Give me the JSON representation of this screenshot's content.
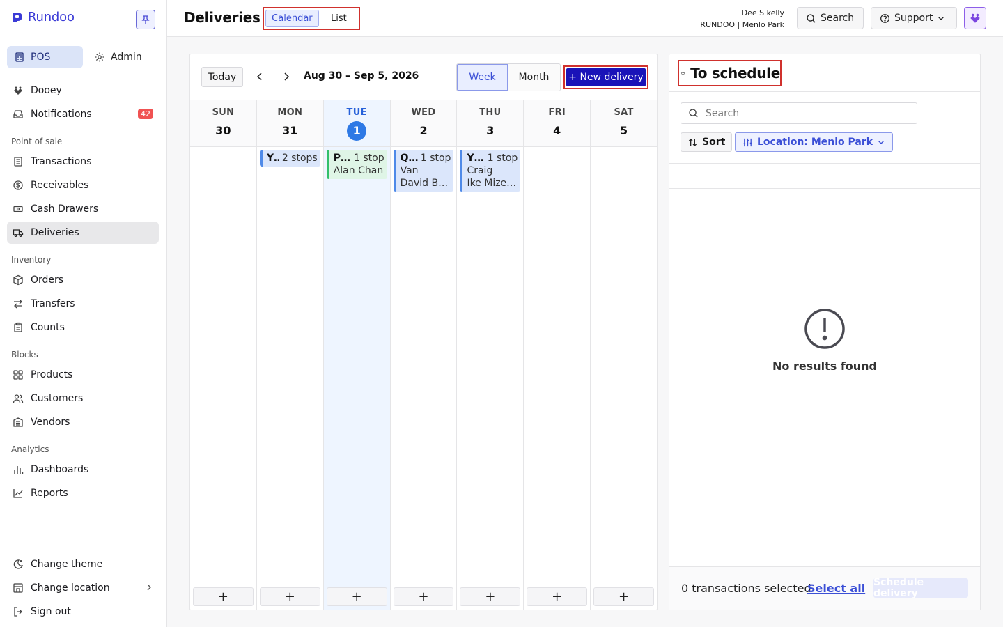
{
  "app": {
    "name": "Rundoo",
    "brand_color": "#3b3bd6"
  },
  "sidebar": {
    "mode_tabs": [
      {
        "label": "POS",
        "icon": "register-icon"
      },
      {
        "label": "Admin",
        "icon": "gear-icon"
      }
    ],
    "top_items": [
      {
        "label": "Dooey",
        "icon": "dooey-icon"
      },
      {
        "label": "Notifications",
        "icon": "inbox-icon",
        "badge": "42"
      }
    ],
    "sections": [
      {
        "title": "Point of sale",
        "items": [
          {
            "label": "Transactions",
            "icon": "receipt-icon"
          },
          {
            "label": "Receivables",
            "icon": "dollar-circle-icon"
          },
          {
            "label": "Cash Drawers",
            "icon": "cash-icon"
          },
          {
            "label": "Deliveries",
            "icon": "truck-icon",
            "active": true
          }
        ]
      },
      {
        "title": "Inventory",
        "items": [
          {
            "label": "Orders",
            "icon": "box-icon"
          },
          {
            "label": "Transfers",
            "icon": "arrows-icon"
          },
          {
            "label": "Counts",
            "icon": "clipboard-icon"
          }
        ]
      },
      {
        "title": "Blocks",
        "items": [
          {
            "label": "Products",
            "icon": "grid-icon"
          },
          {
            "label": "Customers",
            "icon": "users-icon"
          },
          {
            "label": "Vendors",
            "icon": "building-icon"
          }
        ]
      },
      {
        "title": "Analytics",
        "items": [
          {
            "label": "Dashboards",
            "icon": "bar-chart-icon"
          },
          {
            "label": "Reports",
            "icon": "line-chart-icon"
          }
        ]
      }
    ],
    "bottom_items": [
      {
        "label": "Change theme",
        "icon": "theme-icon"
      },
      {
        "label": "Change location",
        "icon": "store-icon"
      },
      {
        "label": "Sign out",
        "icon": "sign-out-icon"
      }
    ]
  },
  "header": {
    "title": "Deliveries",
    "views": [
      "Calendar",
      "List"
    ],
    "active_view": "Calendar",
    "user_name": "Dee S kelly",
    "org_location": "RUNDOO | Menlo Park",
    "search_label": "Search",
    "support_label": "Support"
  },
  "calendar": {
    "today_label": "Today",
    "range": "Aug 30 – Sep 5, 2026",
    "modes": [
      "Week",
      "Month"
    ],
    "active_mode": "Week",
    "new_delivery_label": "+ New delivery",
    "days": [
      {
        "name": "SUN",
        "num": "30",
        "today": false,
        "events": []
      },
      {
        "name": "MON",
        "num": "31",
        "today": false,
        "events": [
          {
            "title": "Y…",
            "stops": "2 stops",
            "lines": [],
            "color": "blue"
          }
        ]
      },
      {
        "name": "TUE",
        "num": "1",
        "today": true,
        "events": [
          {
            "title": "P…",
            "stops": "1 stop",
            "lines": [
              "Alan Chan"
            ],
            "color": "green"
          }
        ]
      },
      {
        "name": "WED",
        "num": "2",
        "today": false,
        "events": [
          {
            "title": "Q…",
            "stops": "1 stop",
            "lines": [
              "Van",
              "David Bo…"
            ],
            "color": "blue"
          }
        ]
      },
      {
        "name": "THU",
        "num": "3",
        "today": false,
        "events": [
          {
            "title": "Y…",
            "stops": "1 stop",
            "lines": [
              "Craig",
              "Ike Mizer…"
            ],
            "color": "blue"
          }
        ]
      },
      {
        "name": "FRI",
        "num": "4",
        "today": false,
        "events": []
      },
      {
        "name": "SAT",
        "num": "5",
        "today": false,
        "events": []
      }
    ],
    "add_label": "+"
  },
  "schedule": {
    "title": "To schedule",
    "search_placeholder": "Search",
    "sort_label": "Sort",
    "location_filter": "Location: Menlo Park",
    "empty_text": "No results found",
    "selected_text": "0 transactions selected",
    "select_all_label": "Select all",
    "schedule_button": "Schedule delivery"
  }
}
